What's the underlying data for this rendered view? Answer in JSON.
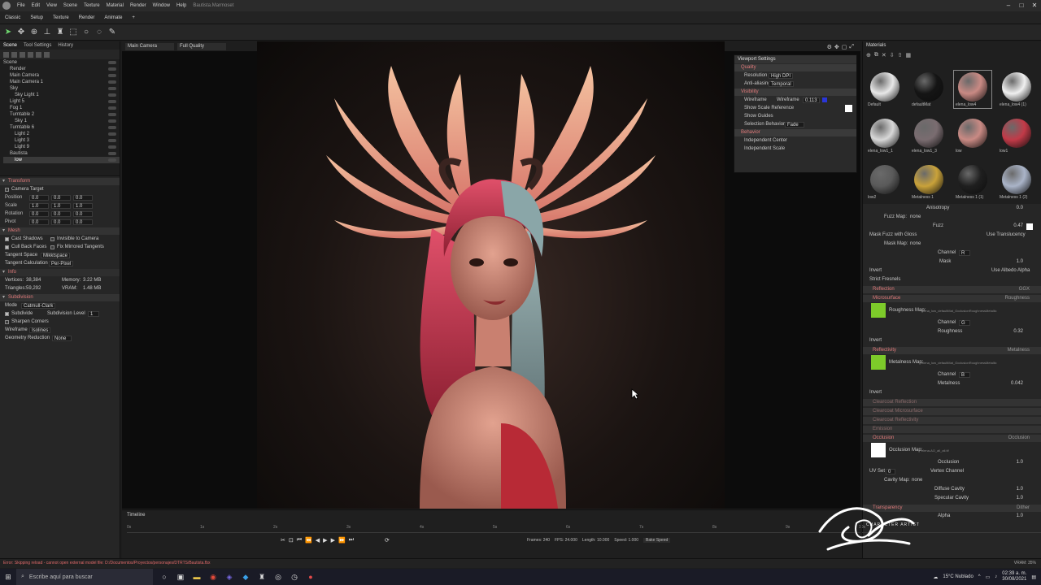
{
  "app": {
    "title": "Bautista.Marmoset",
    "menus": [
      "File",
      "Edit",
      "View",
      "Scene",
      "Texture",
      "Material",
      "Render",
      "Window",
      "Help"
    ]
  },
  "tabs": [
    "Classic",
    "Setup",
    "Texture",
    "Render",
    "Animate",
    "+"
  ],
  "toolbar": {
    "tools": [
      "select-arrow-icon",
      "move-icon",
      "rotate-icon",
      "transform-icon",
      "stamp-icon",
      "marquee-icon",
      "circle-icon",
      "lasso-icon",
      "pen-icon"
    ]
  },
  "left": {
    "tabs": [
      "Scene",
      "Tool Settings",
      "History"
    ],
    "tree": [
      "Scene",
      "Render",
      "Main Camera",
      "Main Camera 1",
      "Sky",
      "Sky Light 1",
      "Light 5",
      "Fog 1",
      "Turntable 2",
      "Sky 1",
      "Turntable 6",
      "Light 2",
      "Light 3",
      "Light 9",
      "Bautista",
      "low"
    ],
    "transform": {
      "title": "Transform",
      "camera_target": "Camera Target",
      "rows": [
        {
          "label": "Position",
          "x": "0.0",
          "y": "0.0",
          "z": "0.0"
        },
        {
          "label": "Scale",
          "x": "1.0",
          "y": "1.0",
          "z": "1.0"
        },
        {
          "label": "Rotation",
          "x": "0.0",
          "y": "0.0",
          "z": "0.0"
        },
        {
          "label": "Pivot",
          "x": "0.0",
          "y": "0.0",
          "z": "0.0"
        }
      ]
    },
    "mesh": {
      "title": "Mesh",
      "cast_shadows": "Cast Shadows",
      "invisible_to_camera": "Invisible to Camera",
      "cull_back_faces": "Cull Back Faces",
      "fix_mirrored": "Fix Mirrored Tangents",
      "tangent_space_label": "Tangent Space",
      "tangent_space_value": "Mikktspace",
      "tangent_calc_label": "Tangent Calculation",
      "tangent_calc_value": "Per-Pixel"
    },
    "info": {
      "title": "Info",
      "vertices_label": "Vertices:",
      "vertices": "38,384",
      "triangles_label": "Triangles:",
      "triangles": "59,292",
      "memory_label": "Memory:",
      "memory": "3.22 MB",
      "vram_label": "VRAM:",
      "vram": "1.48 MB"
    },
    "subdivision": {
      "title": "Subdivision",
      "mode_label": "Mode",
      "mode_value": "Catmull-Clark",
      "subdivide": "Subdivide",
      "level_label": "Subdivision Level",
      "level_value": "1",
      "sharpen": "Sharpen Corners",
      "wireframe_label": "Wireframe",
      "wireframe_value": "Isolines",
      "geo_label": "Geometry Reduction",
      "geo_value": "None"
    }
  },
  "viewport": {
    "camera": "Main Camera",
    "quality": "Full Quality",
    "settings": {
      "title": "Viewport Settings",
      "quality": "Quality",
      "resolution_label": "Resolution",
      "resolution_value": "High DPI",
      "aa_label": "Anti-aliasing",
      "aa_value": "Temporal",
      "visibility": "Visibility",
      "wireframe_label": "Wireframe",
      "wireframe_sub": "Wireframe",
      "wireframe_val": "0.113",
      "show_scale": "Show Scale Reference",
      "show_guides": "Show Guides",
      "sel_label": "Selection Behavior",
      "sel_value": "Fade",
      "behavior": "Behavior",
      "indep_center": "Independent Center",
      "indep_scale": "Independent Scale"
    }
  },
  "right": {
    "title": "Materials",
    "materials": [
      {
        "name": "Default",
        "color": "#e8e8e8"
      },
      {
        "name": "defaultMat",
        "color": "#151515"
      },
      {
        "name": "elena_low4",
        "color": "#c98a84"
      },
      {
        "name": "elena_low4 (1)",
        "color": "#f0f0f0"
      },
      {
        "name": "elena_low1_1",
        "color": "#d8d8d8"
      },
      {
        "name": "elena_low1_3",
        "color": "#7a6c70"
      },
      {
        "name": "low",
        "color": "#c98a84"
      },
      {
        "name": "low1",
        "color": "#c23a48"
      },
      {
        "name": "low2",
        "color": "#5a5a5a"
      },
      {
        "name": "Metalness 1",
        "color": "#c9a23a"
      },
      {
        "name": "Metalness 1 (1)",
        "color": "#1f1f1f"
      },
      {
        "name": "Metalness 1 (2)",
        "color": "#aab4c8"
      }
    ],
    "props": {
      "anisotropy_label": "Anisotropy",
      "anisotropy_val": "0.0",
      "fuzz_map": "Fuzz Map:",
      "fuzz_map_val": "none",
      "fuzz_label": "Fuzz",
      "fuzz_val": "0.47",
      "mask_fuzz": "Mask Fuzz with Gloss",
      "use_transl": "Use Translucency",
      "mask_map": "Mask Map:",
      "mask_map_val": "none",
      "channel_label": "Channel",
      "channel_r": "R",
      "mask_label": "Mask",
      "mask_val": "1.0",
      "invert": "Invert",
      "use_albedo_alpha": "Use Albedo Alpha",
      "strict": "Strict Fresnels",
      "reflection": "Reflection",
      "reflection_right": "GGX",
      "microsurface": "Microsurface",
      "microsurface_right": "Roughness",
      "rough_map_label": "Roughness Map:",
      "rough_map_val": "elena_low_defaultMat_OcclusionRoughnessMetallic",
      "rough_channel": "G",
      "roughness_label": "Roughness",
      "roughness_val": "0.32",
      "reflectivity": "Reflectivity",
      "reflectivity_right": "Metalness",
      "metal_map_label": "Metalness Map:",
      "metal_map_val": "elena_low_defaultMat_OcclusionRoughnessMetallic",
      "metal_channel": "B",
      "metalness_label": "Metalness",
      "metalness_val": "0.042",
      "clearcoat_refl": "Clearcoat Reflection",
      "clearcoat_micro": "Clearcoat Microsurface",
      "clearcoat_reflectivity": "Clearcoat Reflectivity",
      "emission": "Emission",
      "occlusion": "Occlusion",
      "occlusion_right": "Occlusion",
      "occ_map_label": "Occlusion Map:",
      "occ_map_val": "elena-AO_all_all.tif",
      "occlusion_label": "Occlusion",
      "occlusion_val": "1.0",
      "uv_set": "UV Set",
      "uv_val": "0",
      "vertex_channel": "Vertex Channel",
      "cavity_map": "Cavity Map:",
      "cavity_map_val": "none",
      "diffuse_cavity": "Diffuse Cavity",
      "diffuse_cavity_val": "1.0",
      "specular_cavity": "Specular Cavity",
      "specular_cavity_val": "1.0",
      "transparency": "Transparency",
      "transparency_right": "Dither",
      "alpha_label": "Alpha",
      "alpha_val": "1.0",
      "character_artist": "CHARACTER ARTIST"
    }
  },
  "timeline": {
    "title": "Timeline",
    "ticks": [
      "0s",
      "1s",
      "2s",
      "3s",
      "4s",
      "5s",
      "6s",
      "7s",
      "8s",
      "9s",
      "10s"
    ],
    "frames_label": "Frames:",
    "frames": "240",
    "fps_label": "FPS:",
    "fps": "24.000",
    "length_label": "Length:",
    "length": "10.000",
    "speed_label": "Speed:",
    "speed": "1.000",
    "bake": "Bake Speed"
  },
  "status": {
    "error": "Error: Skipping reload - cannot open external model file: D:/Documentos/Proyectos/personajes/DTRTS/Bautista.fbx",
    "vram": "VRAM: 35%"
  },
  "taskbar": {
    "search": "Escribe aquí para buscar",
    "weather": "15°C Nublado",
    "time": "02:39 a. m.",
    "date": "30/08/2021"
  },
  "colors": {
    "accent_red": "#e07a7a",
    "panel": "#262626",
    "viewport": "#0c0c0c"
  }
}
